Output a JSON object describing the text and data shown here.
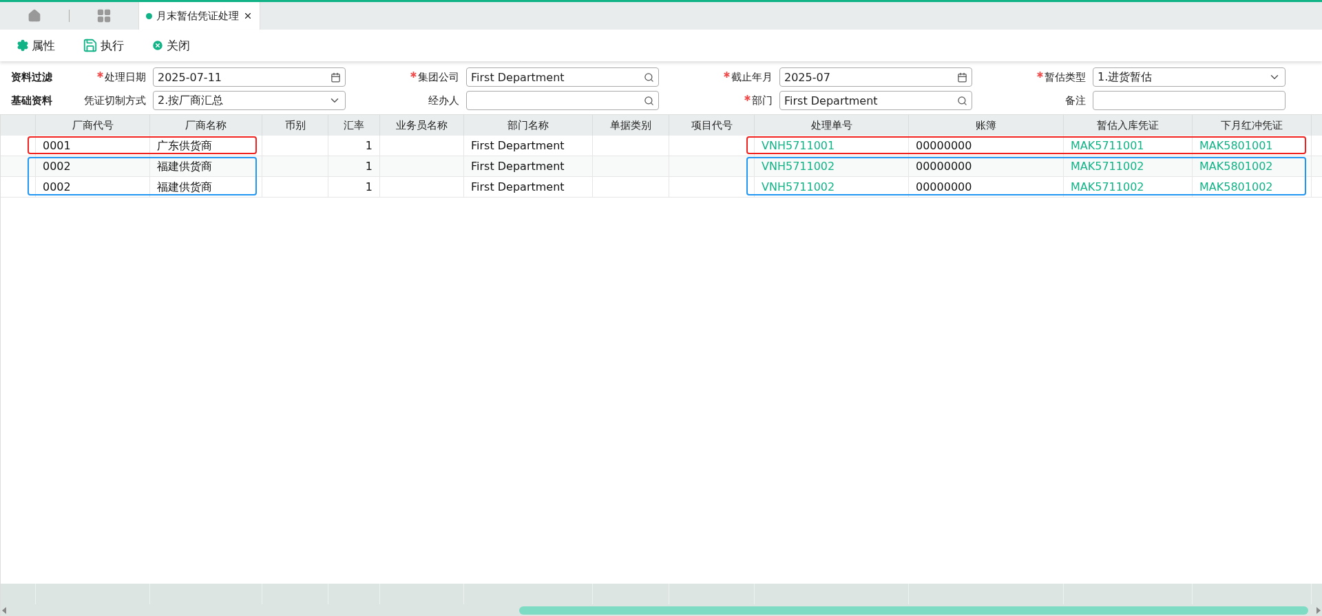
{
  "tabs": [
    {
      "label": "月末暂估凭证处理",
      "selected": true
    }
  ],
  "toolbar": [
    {
      "label": "属性",
      "kind": "settings"
    },
    {
      "label": "执行",
      "kind": "save"
    },
    {
      "label": "关闭",
      "kind": "close"
    }
  ],
  "filter": {
    "sections": [
      "资料过滤",
      "基础资料"
    ],
    "rows": [
      [
        {
          "label": "处理日期",
          "required": true,
          "value": "2025-07-11",
          "kind": "date"
        },
        {
          "label": "集团公司",
          "required": true,
          "value": "First Department",
          "kind": "search"
        },
        {
          "label": "截止年月",
          "required": true,
          "value": "2025-07",
          "kind": "date"
        },
        {
          "label": "暂估类型",
          "required": true,
          "value": "1.进货暂估",
          "kind": "select"
        }
      ],
      [
        {
          "label": "凭证切制方式",
          "required": false,
          "value": "2.按厂商汇总",
          "kind": "select"
        },
        {
          "label": "经办人",
          "required": false,
          "kind": "search"
        },
        {
          "label": "部门",
          "required": true,
          "value": "First Department",
          "kind": "search"
        },
        {
          "label": "备注",
          "required": false,
          "kind": "text"
        }
      ]
    ]
  },
  "table": {
    "columns": [
      {
        "label": "厂商代号",
        "kind": "text"
      },
      {
        "label": "厂商名称",
        "kind": "text"
      },
      {
        "label": "币别",
        "kind": "text"
      },
      {
        "label": "汇率",
        "kind": "number"
      },
      {
        "label": "业务员名称",
        "kind": "text"
      },
      {
        "label": "部门名称",
        "kind": "text"
      },
      {
        "label": "单据类别",
        "kind": "text"
      },
      {
        "label": "项目代号",
        "kind": "text"
      },
      {
        "label": "处理单号",
        "kind": "link"
      },
      {
        "label": "账簿",
        "kind": "text"
      },
      {
        "label": "暂估入库凭证",
        "kind": "link"
      },
      {
        "label": "下月红冲凭证",
        "kind": "link"
      }
    ],
    "rows": [
      {
        "color": "#f0211f",
        "cells": [
          "0001",
          "广东供货商",
          "",
          "1",
          "",
          "First Department",
          "",
          "",
          "VNH5711001",
          "00000000",
          "MAK5711001",
          "MAK5801001"
        ]
      },
      {
        "color": "#2196f3",
        "cells": [
          "0002",
          "福建供货商",
          "",
          "1",
          "",
          "First Department",
          "",
          "",
          "VNH5711002",
          "00000000",
          "MAK5711002",
          "MAK5801002"
        ]
      },
      {
        "color": "#2196f3",
        "cells": [
          "0002",
          "福建供货商",
          "",
          "1",
          "",
          "First Department",
          "",
          "",
          "VNH5711002",
          "00000000",
          "MAK5711002",
          "MAK5801002"
        ]
      }
    ]
  }
}
